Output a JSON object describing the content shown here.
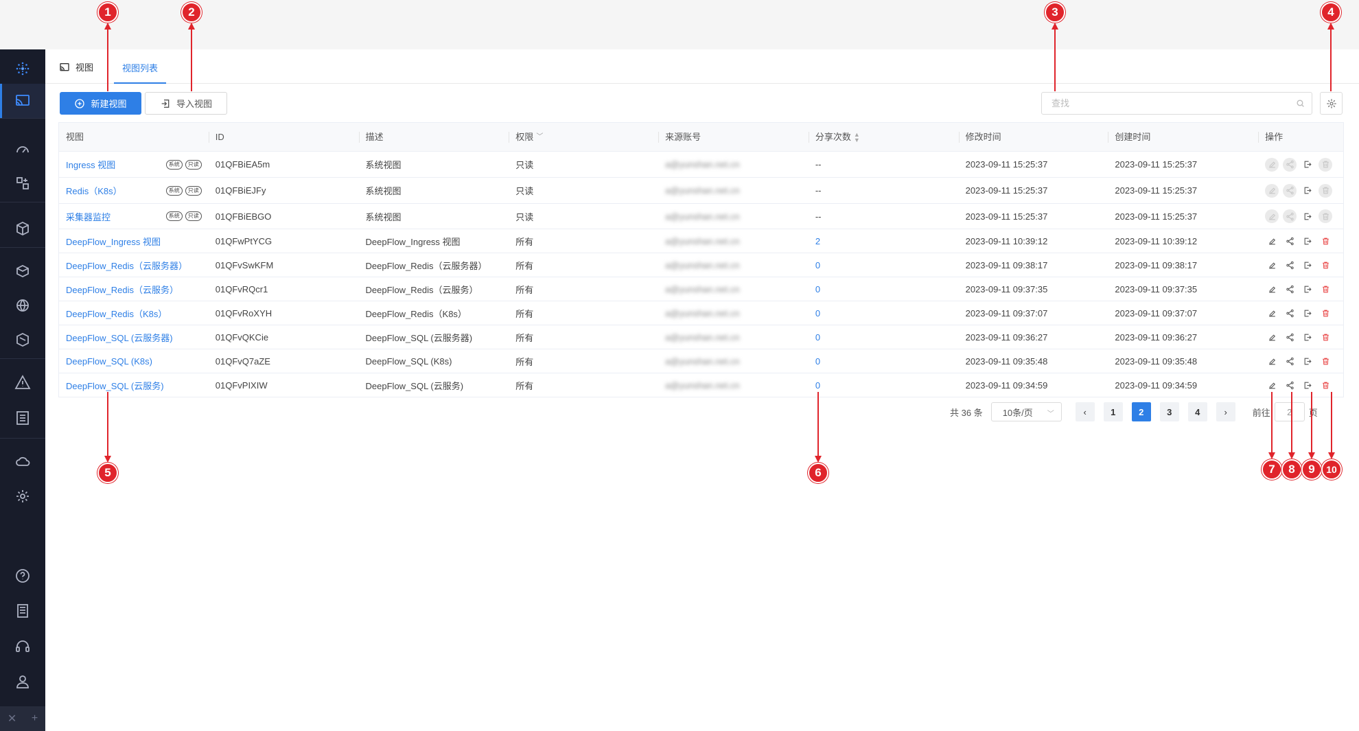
{
  "tabs": {
    "view": "视图",
    "view_list": "视图列表"
  },
  "toolbar": {
    "new_view": "新建视图",
    "import_view": "导入视图",
    "search_placeholder": "查找"
  },
  "table": {
    "headers": [
      "视图",
      "ID",
      "描述",
      "权限",
      "来源账号",
      "分享次数",
      "修改时间",
      "创建时间",
      "操作"
    ],
    "rows": [
      {
        "name": "Ingress 视图",
        "tags": [
          "系统",
          "只读"
        ],
        "id": "01QFBiEA5m",
        "desc": "系统视图",
        "perm": "只读",
        "account": "a@yunshan.net.cn",
        "shares": "--",
        "modified": "2023-09-11 15:25:37",
        "created": "2023-09-11 15:25:37",
        "disabled": true
      },
      {
        "name": "Redis（K8s）",
        "tags": [
          "系统",
          "只读"
        ],
        "id": "01QFBiEJFy",
        "desc": "系统视图",
        "perm": "只读",
        "account": "a@yunshan.net.cn",
        "shares": "--",
        "modified": "2023-09-11 15:25:37",
        "created": "2023-09-11 15:25:37",
        "disabled": true
      },
      {
        "name": "采集器监控",
        "tags": [
          "系统",
          "只读"
        ],
        "id": "01QFBiEBGO",
        "desc": "系统视图",
        "perm": "只读",
        "account": "a@yunshan.net.cn",
        "shares": "--",
        "modified": "2023-09-11 15:25:37",
        "created": "2023-09-11 15:25:37",
        "disabled": true
      },
      {
        "name": "DeepFlow_Ingress 视图",
        "tags": [],
        "id": "01QFwPtYCG",
        "desc": "DeepFlow_Ingress 视图",
        "perm": "所有",
        "account": "a@yunshan.net.cn",
        "shares": "2",
        "modified": "2023-09-11 10:39:12",
        "created": "2023-09-11 10:39:12",
        "disabled": false
      },
      {
        "name": "DeepFlow_Redis（云服务器）",
        "tags": [],
        "id": "01QFvSwKFM",
        "desc": "DeepFlow_Redis（云服务器）",
        "perm": "所有",
        "account": "a@yunshan.net.cn",
        "shares": "0",
        "modified": "2023-09-11 09:38:17",
        "created": "2023-09-11 09:38:17",
        "disabled": false
      },
      {
        "name": "DeepFlow_Redis（云服务）",
        "tags": [],
        "id": "01QFvRQcr1",
        "desc": "DeepFlow_Redis（云服务）",
        "perm": "所有",
        "account": "a@yunshan.net.cn",
        "shares": "0",
        "modified": "2023-09-11 09:37:35",
        "created": "2023-09-11 09:37:35",
        "disabled": false
      },
      {
        "name": "DeepFlow_Redis（K8s）",
        "tags": [],
        "id": "01QFvRoXYH",
        "desc": "DeepFlow_Redis（K8s）",
        "perm": "所有",
        "account": "a@yunshan.net.cn",
        "shares": "0",
        "modified": "2023-09-11 09:37:07",
        "created": "2023-09-11 09:37:07",
        "disabled": false
      },
      {
        "name": "DeepFlow_SQL (云服务器)",
        "tags": [],
        "id": "01QFvQKCie",
        "desc": "DeepFlow_SQL (云服务器)",
        "perm": "所有",
        "account": "a@yunshan.net.cn",
        "shares": "0",
        "modified": "2023-09-11 09:36:27",
        "created": "2023-09-11 09:36:27",
        "disabled": false
      },
      {
        "name": "DeepFlow_SQL (K8s)",
        "tags": [],
        "id": "01QFvQ7aZE",
        "desc": "DeepFlow_SQL (K8s)",
        "perm": "所有",
        "account": "a@yunshan.net.cn",
        "shares": "0",
        "modified": "2023-09-11 09:35:48",
        "created": "2023-09-11 09:35:48",
        "disabled": false
      },
      {
        "name": "DeepFlow_SQL (云服务)",
        "tags": [],
        "id": "01QFvPIXIW",
        "desc": "DeepFlow_SQL (云服务)",
        "perm": "所有",
        "account": "a@yunshan.net.cn",
        "shares": "0",
        "modified": "2023-09-11 09:34:59",
        "created": "2023-09-11 09:34:59",
        "disabled": false
      }
    ]
  },
  "pagination": {
    "total": "共 36 条",
    "page_size": "10条/页",
    "pages": [
      "1",
      "2",
      "3",
      "4"
    ],
    "current": "2",
    "goto_label": "前往",
    "goto_value": "2",
    "page_suffix": "页"
  },
  "callouts": [
    "1",
    "2",
    "3",
    "4",
    "5",
    "6",
    "7",
    "8",
    "9",
    "10"
  ],
  "colors": {
    "accent": "#2e7fe6",
    "sidebar": "#181c2a",
    "callout": "#e0242b",
    "delete": "#e94a4a"
  }
}
